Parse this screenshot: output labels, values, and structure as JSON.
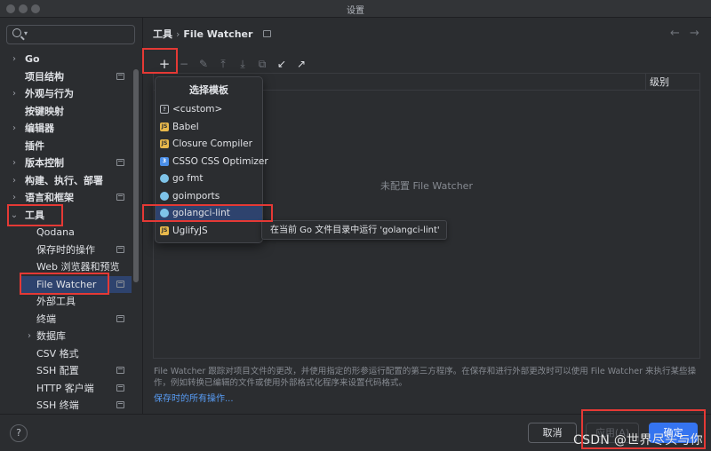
{
  "window": {
    "title": "设置"
  },
  "sidebar": {
    "items": [
      {
        "label": "Go",
        "chevron": "›",
        "bold": true,
        "proj": false
      },
      {
        "label": "项目结构",
        "chevron": "",
        "bold": true,
        "proj": true
      },
      {
        "label": "外观与行为",
        "chevron": "›",
        "bold": true,
        "proj": false
      },
      {
        "label": "按键映射",
        "chevron": "",
        "bold": true,
        "proj": false
      },
      {
        "label": "编辑器",
        "chevron": "›",
        "bold": true,
        "proj": false
      },
      {
        "label": "插件",
        "chevron": "",
        "bold": true,
        "proj": false
      },
      {
        "label": "版本控制",
        "chevron": "›",
        "bold": true,
        "proj": true
      },
      {
        "label": "构建、执行、部署",
        "chevron": "›",
        "bold": true,
        "proj": false
      },
      {
        "label": "语言和框架",
        "chevron": "›",
        "bold": true,
        "proj": true
      },
      {
        "label": "工具",
        "chevron": "⌄",
        "bold": true,
        "proj": false
      },
      {
        "label": "Qodana",
        "chevron": "",
        "bold": false,
        "proj": false
      },
      {
        "label": "保存时的操作",
        "chevron": "",
        "bold": false,
        "proj": true
      },
      {
        "label": "Web 浏览器和预览",
        "chevron": "",
        "bold": false,
        "proj": false
      },
      {
        "label": "File Watcher",
        "chevron": "",
        "bold": false,
        "proj": true
      },
      {
        "label": "外部工具",
        "chevron": "",
        "bold": false,
        "proj": false
      },
      {
        "label": "终端",
        "chevron": "",
        "bold": false,
        "proj": true
      },
      {
        "label": "数据库",
        "chevron": "›",
        "bold": false,
        "proj": false
      },
      {
        "label": "CSV 格式",
        "chevron": "",
        "bold": false,
        "proj": false
      },
      {
        "label": "SSH 配置",
        "chevron": "",
        "bold": false,
        "proj": true
      },
      {
        "label": "HTTP 客户端",
        "chevron": "",
        "bold": false,
        "proj": true
      },
      {
        "label": "SSH 终端",
        "chevron": "",
        "bold": false,
        "proj": true
      }
    ]
  },
  "breadcrumb": {
    "parent": "工具",
    "sep": "›",
    "current": "File Watcher"
  },
  "nav": {
    "back": "←",
    "forward": "→"
  },
  "toolbar": {
    "add": "+",
    "remove": "−",
    "edit": "✎",
    "move_up": "⤒",
    "move_down": "⤓",
    "copy": "⧉",
    "import": "↙",
    "export": "↗"
  },
  "table": {
    "column_level": "级别",
    "empty_text": "未配置 File Watcher"
  },
  "popup": {
    "title": "选择模板",
    "items": [
      {
        "label": "<custom>",
        "icon": "custom",
        "glyph": "?"
      },
      {
        "label": "Babel",
        "icon": "js",
        "glyph": "JS"
      },
      {
        "label": "Closure Compiler",
        "icon": "js",
        "glyph": "JS"
      },
      {
        "label": "CSSO CSS Optimizer",
        "icon": "css",
        "glyph": "3"
      },
      {
        "label": "go fmt",
        "icon": "go",
        "glyph": ""
      },
      {
        "label": "goimports",
        "icon": "go",
        "glyph": ""
      },
      {
        "label": "golangci-lint",
        "icon": "go",
        "glyph": ""
      },
      {
        "label": "UglifyJS",
        "icon": "js",
        "glyph": "JS"
      }
    ]
  },
  "tooltip": {
    "text": "在当前 Go 文件目录中运行 'golangci-lint'"
  },
  "description": {
    "text": "File Watcher 跟踪对项目文件的更改，并使用指定的形参运行配置的第三方程序。在保存和进行外部更改时可以使用 File Watcher 来执行某些操作，例如转换已编辑的文件或使用外部格式化程序来设置代码格式。",
    "link": "保存时的所有操作..."
  },
  "footer": {
    "help": "?",
    "cancel": "取消",
    "apply": "应用(A)",
    "ok": "确定"
  },
  "watermark": "CSDN @世界尽头与你",
  "colors": {
    "accent": "#3574f0",
    "highlight_box": "#e53935",
    "selection": "#2e436e"
  }
}
